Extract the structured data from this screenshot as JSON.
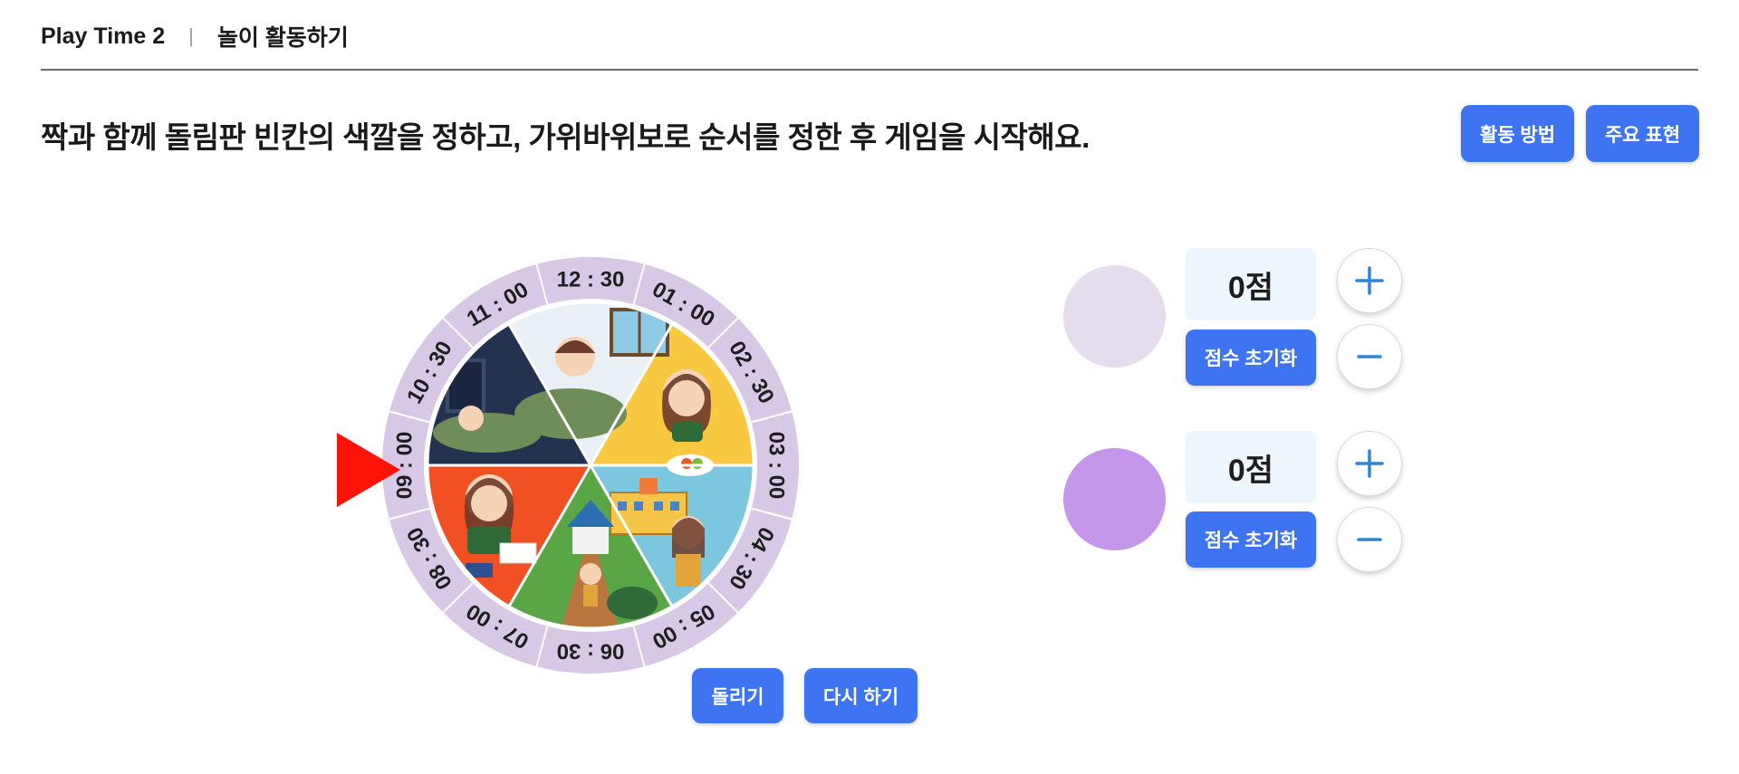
{
  "header": {
    "title": "Play Time 2",
    "separator": "|",
    "subtitle": "놀이 활동하기"
  },
  "instruction": "짝과 함께 돌림판 빈칸의 색깔을 정하고, 가위바위보로 순서를 정한 후 게임을 시작해요.",
  "top_buttons": {
    "how_to": "활동 방법",
    "key_expressions": "주요 표현"
  },
  "wheel": {
    "times": [
      "01 : 00",
      "02 : 30",
      "03 : 00",
      "04 : 30",
      "05 : 00",
      "06 : 30",
      "07 : 00",
      "08 : 30",
      "09 : 00",
      "10 : 30",
      "11 : 00",
      "12 : 30"
    ],
    "segments": [
      {
        "scene": "waking up",
        "color": "#e9f1f6"
      },
      {
        "scene": "eating breakfast",
        "color": "#f8c940"
      },
      {
        "scene": "going to school",
        "color": "#7cc7dd"
      },
      {
        "scene": "walking home",
        "color": "#5aa647"
      },
      {
        "scene": "reading a book",
        "color": "#f05022"
      },
      {
        "scene": "sleeping",
        "color": "#23324f"
      }
    ],
    "ring_color": "#d7c8e6",
    "pointer_color": "#ff1308"
  },
  "controls": {
    "spin": "돌리기",
    "reset": "다시 하기"
  },
  "players": [
    {
      "color": "#e5dcee",
      "score": "0점",
      "reset_label": "점수 초기화"
    },
    {
      "color": "#c597ea",
      "score": "0점",
      "reset_label": "점수 초기화"
    }
  ],
  "accent": "#3e74f2"
}
